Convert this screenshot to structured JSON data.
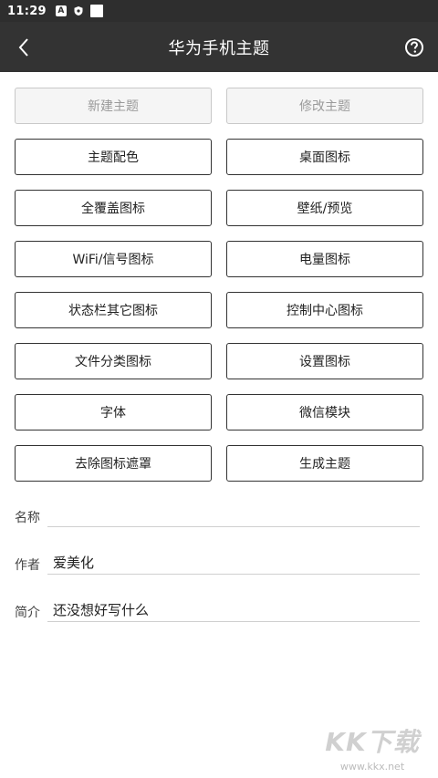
{
  "status_bar": {
    "time": "11:29",
    "icons": [
      "a-notification-icon",
      "shield-icon",
      "white-square-icon"
    ]
  },
  "app_bar": {
    "title": "华为手机主题",
    "back_icon": "chevron-left-icon",
    "help_icon": "help-circle-icon"
  },
  "buttons": [
    {
      "label": "新建主题",
      "disabled": true
    },
    {
      "label": "修改主题",
      "disabled": true
    },
    {
      "label": "主题配色"
    },
    {
      "label": "桌面图标"
    },
    {
      "label": "全覆盖图标"
    },
    {
      "label": "壁纸/预览"
    },
    {
      "label": "WiFi/信号图标"
    },
    {
      "label": "电量图标"
    },
    {
      "label": "状态栏其它图标"
    },
    {
      "label": "控制中心图标"
    },
    {
      "label": "文件分类图标"
    },
    {
      "label": "设置图标"
    },
    {
      "label": "字体"
    },
    {
      "label": "微信模块"
    },
    {
      "label": "去除图标遮罩"
    },
    {
      "label": "生成主题"
    }
  ],
  "form": {
    "name": {
      "label": "名称",
      "value": ""
    },
    "author": {
      "label": "作者",
      "value": "爱美化"
    },
    "intro": {
      "label": "简介",
      "value": "还没想好写什么"
    }
  },
  "watermark": {
    "logo": "KK下载",
    "url": "www.kkx.net"
  }
}
